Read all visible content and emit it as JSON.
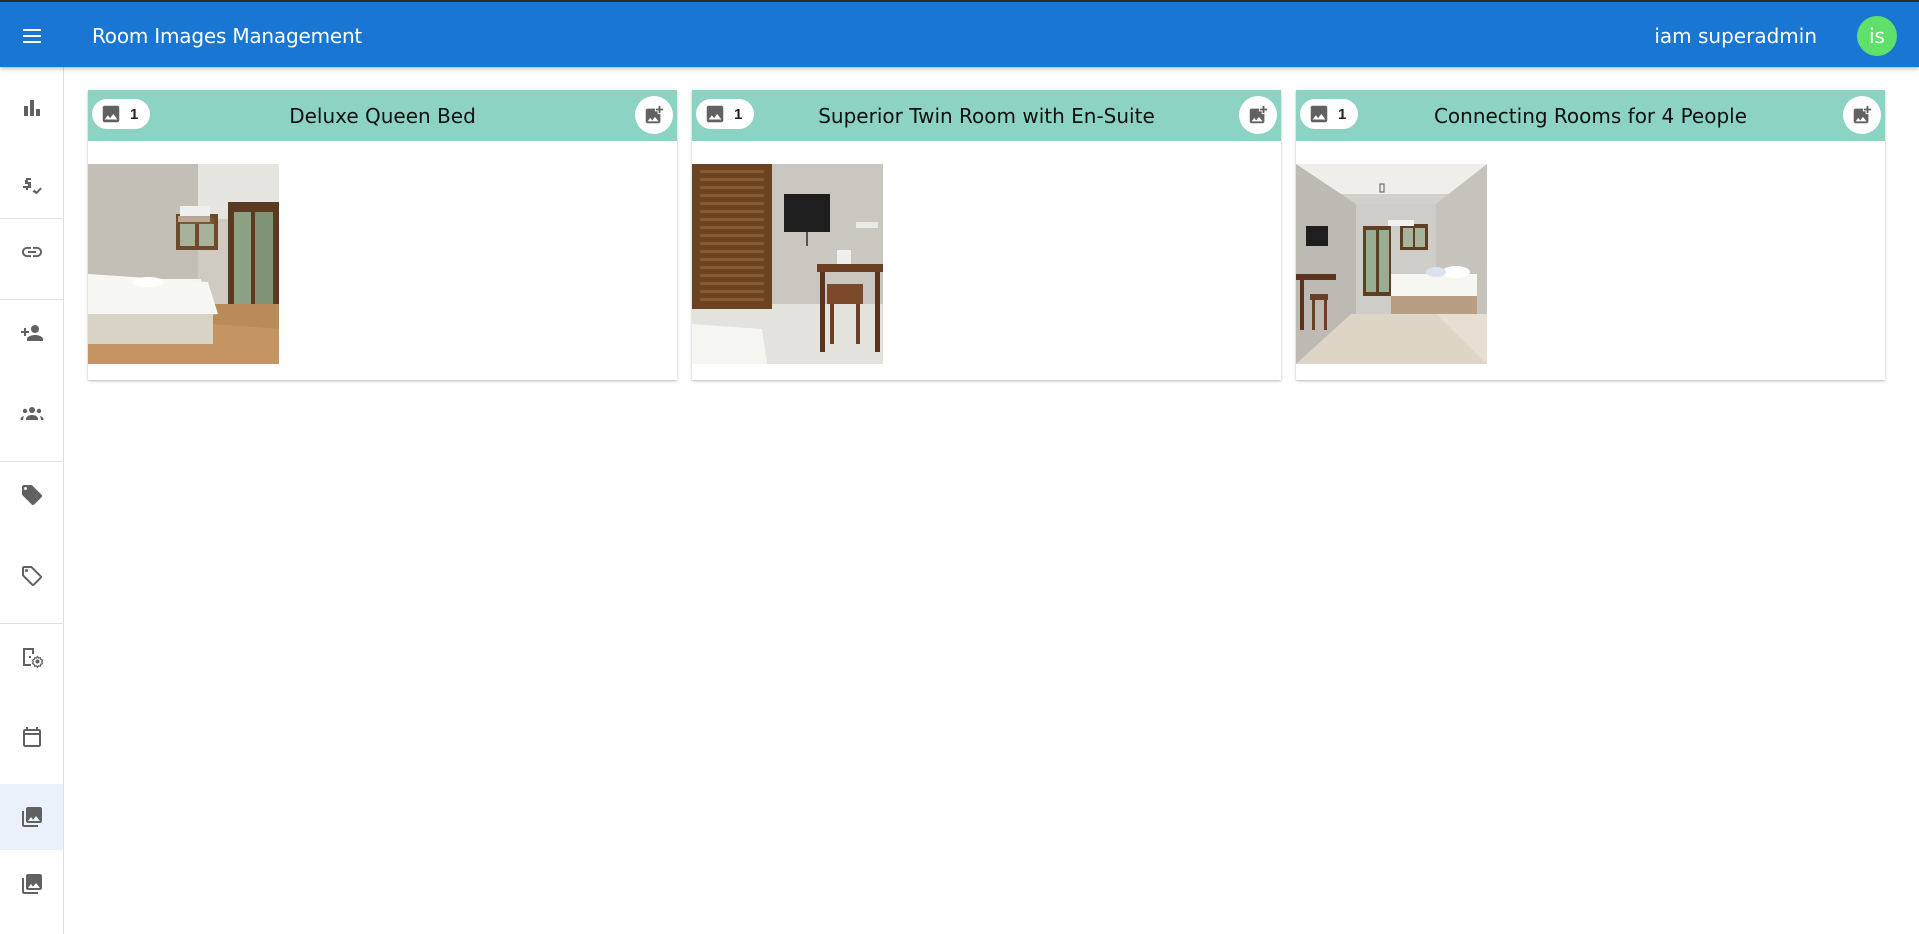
{
  "appbar": {
    "title": "Room Images Management",
    "user_name": "iam superadmin",
    "avatar_initials": "is",
    "color": "#1976d2",
    "avatar_color": "#5fe06a"
  },
  "sidebar": {
    "items": [
      {
        "icon": "bar-chart-icon"
      },
      {
        "icon": "price-check-icon"
      },
      {
        "icon": "link-icon"
      },
      {
        "icon": "person-add-icon"
      },
      {
        "icon": "groups-icon"
      },
      {
        "icon": "tag-icon"
      },
      {
        "icon": "tag-outline-icon"
      },
      {
        "icon": "room-settings-icon"
      },
      {
        "icon": "calendar-icon"
      },
      {
        "icon": "photo-library-icon",
        "active": true
      },
      {
        "icon": "photo-library-icon"
      }
    ]
  },
  "rooms": [
    {
      "title": "Deluxe Queen Bed",
      "image_count": "1",
      "header_color": "#8cd3c3"
    },
    {
      "title": "Superior Twin Room with En-Suite",
      "image_count": "1",
      "header_color": "#8cd3c3"
    },
    {
      "title": "Connecting Rooms for 4 People",
      "image_count": "1",
      "header_color": "#8cd3c3"
    }
  ]
}
